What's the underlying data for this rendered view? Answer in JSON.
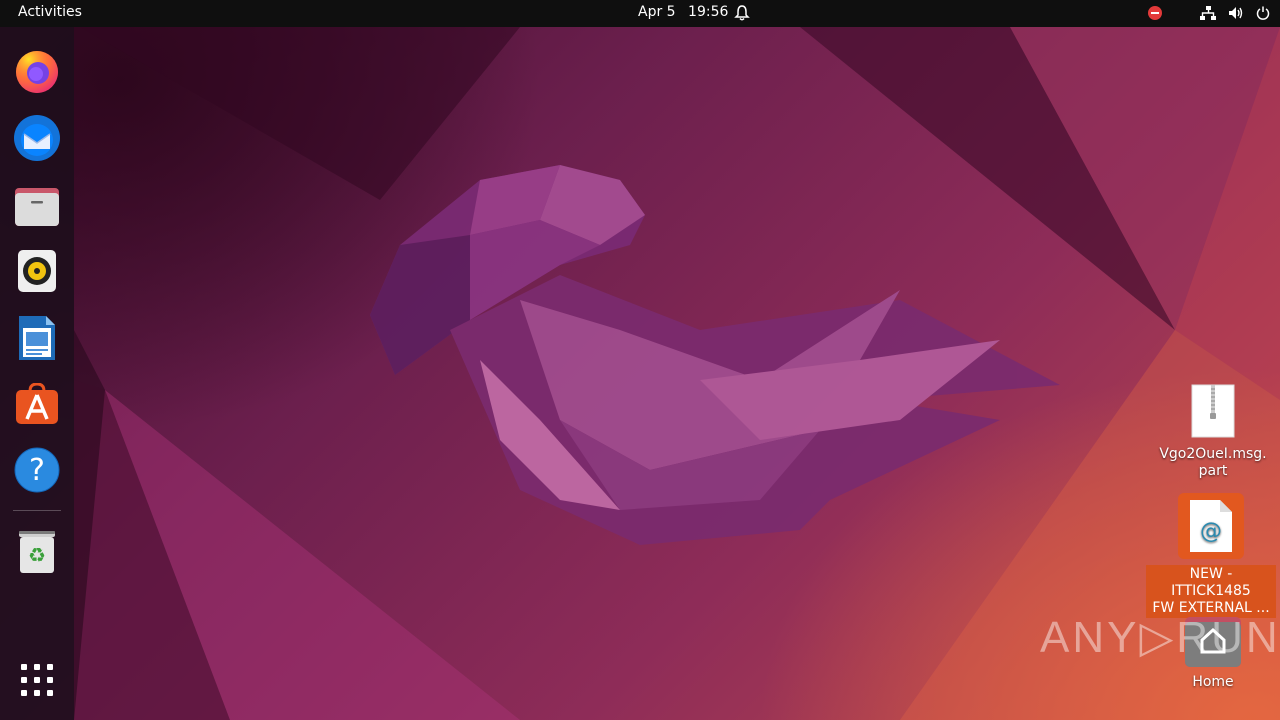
{
  "topbar": {
    "activities_label": "Activities",
    "date": "Apr 5",
    "time": "19:56"
  },
  "dock": {
    "items": [
      {
        "name": "firefox"
      },
      {
        "name": "thunderbird"
      },
      {
        "name": "files"
      },
      {
        "name": "rhythmbox"
      },
      {
        "name": "libreoffice-writer"
      },
      {
        "name": "ubuntu-software"
      },
      {
        "name": "help"
      },
      {
        "name": "trash"
      },
      {
        "name": "show-applications"
      }
    ]
  },
  "desktop": {
    "icons": [
      {
        "label_line1": "Vgo2OueI.msg.",
        "label_line2": "part",
        "icon": "zip-file-icon"
      },
      {
        "label_line1": "NEW - ITTICK1485",
        "label_line2": "FW EXTERNAL ...",
        "icon": "email-file-icon",
        "selected": true
      },
      {
        "label_line1": "Home",
        "icon": "home-folder-icon"
      }
    ]
  },
  "watermark": {
    "text": "ANY▷RUN"
  },
  "colors": {
    "topbar": "#0f0f0f",
    "selection": "#e2581f",
    "alert": "#e33a3a"
  }
}
